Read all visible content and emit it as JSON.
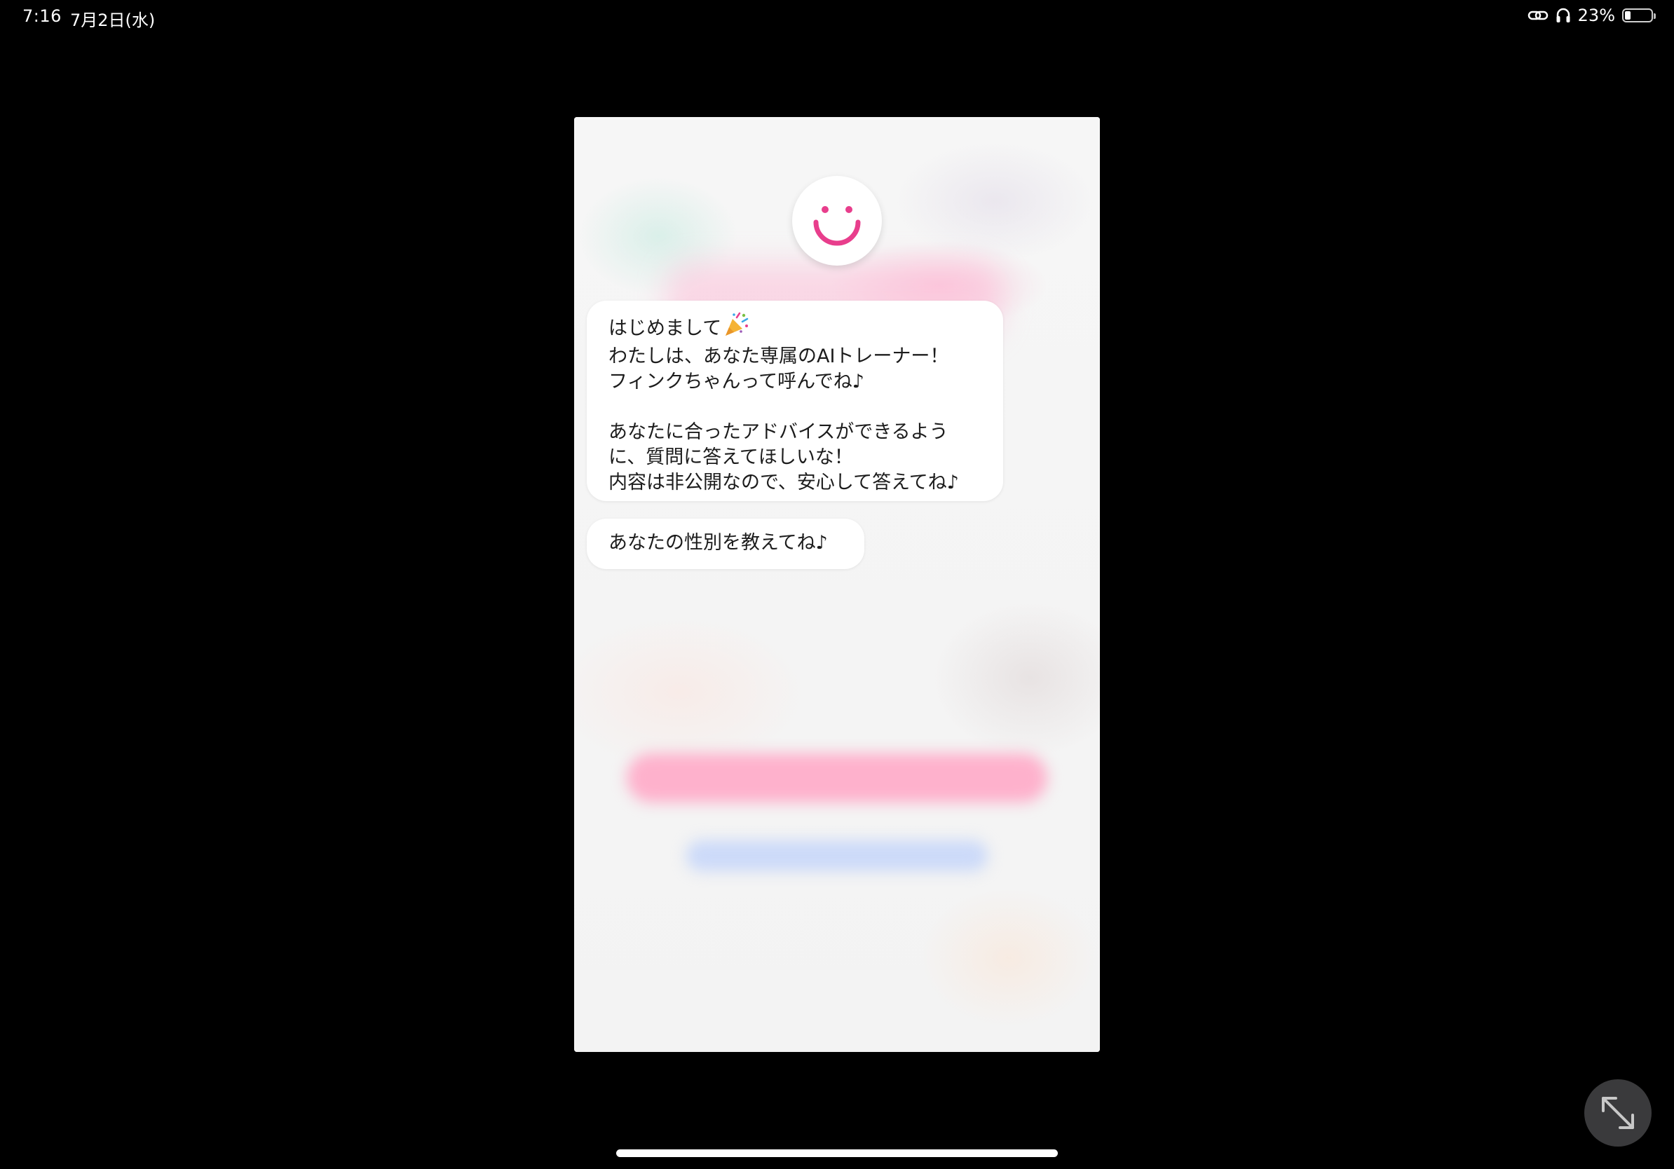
{
  "status_bar": {
    "time": "7:16",
    "date": "7月2日(水)",
    "battery_percent": "23%",
    "battery_level": 0.23,
    "icons": [
      "link-icon",
      "headphones-icon",
      "battery-icon"
    ]
  },
  "chat": {
    "avatar_icon": "smiley-face-icon",
    "accent_color": "#e83e8c",
    "messages": [
      {
        "lines": [
          "はじめまして",
          "わたしは、あなた専属のAIトレーナー！",
          "フィンクちゃんって呼んでね♪",
          "",
          "あなたに合ったアドバイスができるよう",
          "に、質問に答えてほしいな！",
          "内容は非公開なので、安心して答えてね♪"
        ],
        "emoji": "party-popper-icon"
      },
      {
        "lines": [
          "あなたの性別を教えてね♪"
        ]
      }
    ]
  },
  "controls": {
    "expand_icon": "expand-arrows-icon"
  }
}
